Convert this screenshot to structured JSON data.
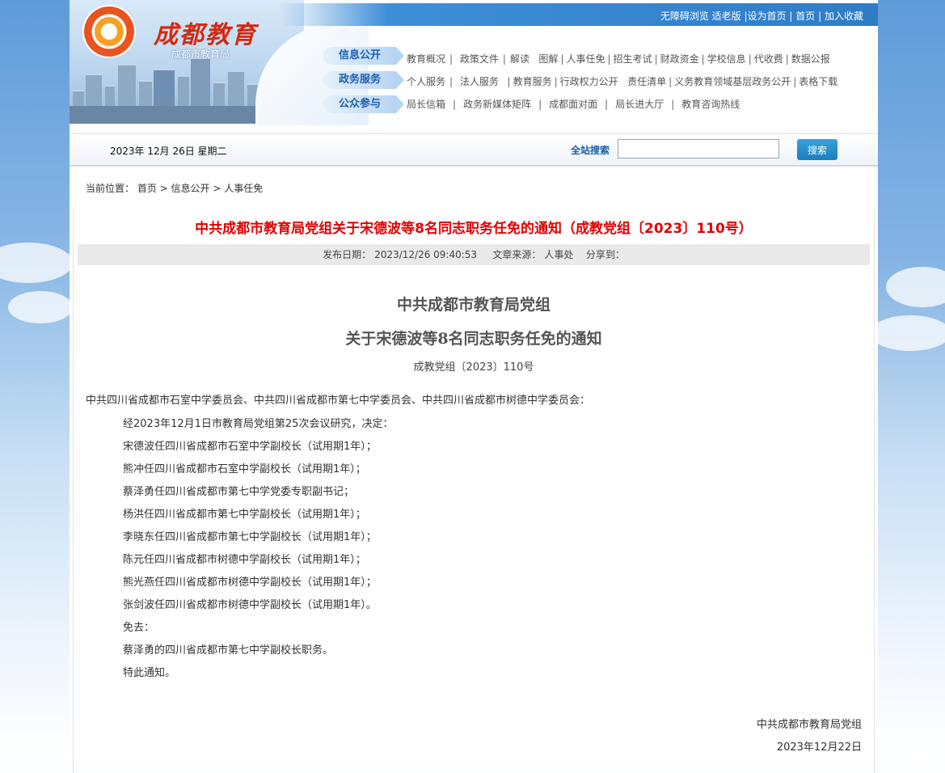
{
  "top_links": [
    "无障碍浏览",
    "适老版",
    "设为首页",
    "首页",
    "加入收藏"
  ],
  "logo": {
    "title": "成都教育",
    "subtitle": "成都市教育局"
  },
  "nav": {
    "rows": [
      {
        "tab": "信息公开",
        "links": [
          "教育概况",
          "政策文件",
          "解读",
          "图解",
          "人事任免",
          "招生考试",
          "财政资金",
          "学校信息",
          "代收费",
          "数据公报"
        ]
      },
      {
        "tab": "政务服务",
        "links": [
          "个人服务",
          "法人服务",
          "教育服务",
          "行政权力公开",
          "责任清单",
          "义务教育领域基层政务公开",
          "表格下载"
        ]
      },
      {
        "tab": "公众参与",
        "links": [
          "局长信箱",
          "政务新媒体矩阵",
          "成都面对面",
          "局长进大厅",
          "教育咨询热线"
        ]
      }
    ]
  },
  "infobar": {
    "date": "2023年  12月  26日  星期二",
    "search_label": "全站搜索",
    "search_value": "",
    "search_button": "搜索"
  },
  "breadcrumb": {
    "prefix": "当前位置：",
    "items": [
      "首页",
      "信息公开",
      "人事任免"
    ],
    "sep": " > "
  },
  "article": {
    "title": "中共成都市教育局党组关于宋德波等8名同志职务任免的通知（成教党组〔2023〕110号）",
    "publish_label": "发布日期：",
    "publish_date": "2023/12/26 09:40:53",
    "source_label": "文章来源：",
    "source": "人事处",
    "share_label": "分享到："
  },
  "document": {
    "head1": "中共成都市教育局党组",
    "head2": "关于宋德波等8名同志职务任免的通知",
    "doc_no": "成教党组〔2023〕110号",
    "addressee": "中共四川省成都市石室中学委员会、中共四川省成都市第七中学委员会、中共四川省成都市树德中学委员会：",
    "paragraphs": [
      "经2023年12月1日市教育局党组第25次会议研究，决定：",
      "宋德波任四川省成都市石室中学副校长（试用期1年）；",
      "熊冲任四川省成都市石室中学副校长（试用期1年）；",
      "蔡泽勇任四川省成都市第七中学党委专职副书记；",
      "杨洪任四川省成都市第七中学副校长（试用期1年）；",
      "李晓东任四川省成都市第七中学副校长（试用期1年）；",
      "陈元任四川省成都市树德中学副校长（试用期1年）；",
      "熊光燕任四川省成都市树德中学副校长（试用期1年）；",
      "张剑波任四川省成都市树德中学副校长（试用期1年）。",
      "免去：",
      "蔡泽勇的四川省成都市第七中学副校长职务。",
      "特此通知。"
    ],
    "signature": "中共成都市教育局党组",
    "sign_date": "2023年12月22日"
  }
}
